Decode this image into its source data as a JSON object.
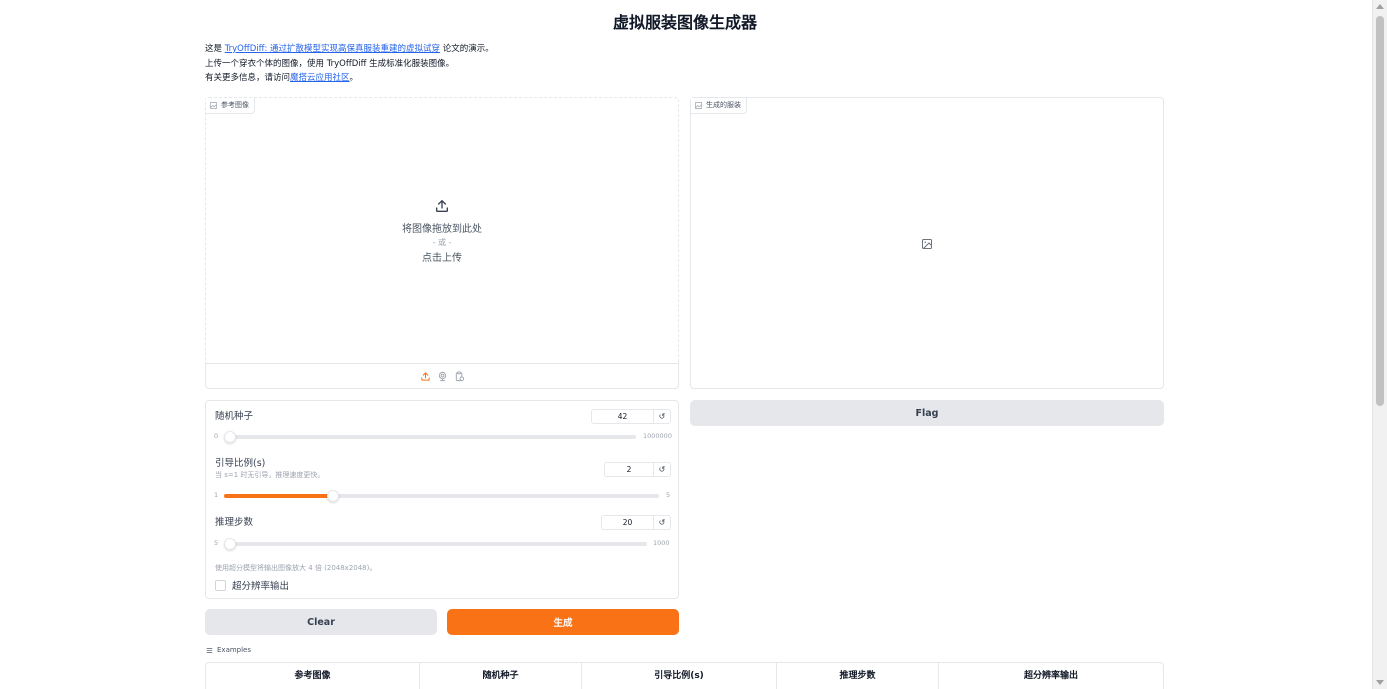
{
  "title": "虚拟服装图像生成器",
  "description": {
    "line1_prefix": "这是 ",
    "line1_link": "TryOffDiff: 通过扩散模型实现高保真服装重建的虚拟试穿",
    "line1_suffix": " 论文的演示。",
    "line2": "上传一个穿衣个体的图像，使用 TryOffDiff 生成标准化服装图像。",
    "line3_prefix": "有关更多信息，请访问",
    "line3_link": "魔搭云应用社区",
    "line3_suffix": "。"
  },
  "input_panel": {
    "label": "参考图像",
    "drop_text": "将图像拖放到此处",
    "or_text": "- 或 -",
    "click_text": "点击上传"
  },
  "output_panel": {
    "label": "生成的服装"
  },
  "seed": {
    "label": "随机种子",
    "value": "42",
    "min": "0",
    "max": "1000000",
    "level": 4.2e-05
  },
  "guidance": {
    "label": "引导比例(s)",
    "info": "当 s=1 时无引导，推理速度更快。",
    "value": "2",
    "min": "1",
    "max": "5",
    "level": 0.25
  },
  "steps": {
    "label": "推理步数",
    "value": "20",
    "min": "5",
    "max": "1000",
    "level": 0.015
  },
  "superres": {
    "info": "使用超分模型将输出图像放大 4 倍 (2048x2048)。",
    "label": "超分辨率输出"
  },
  "buttons": {
    "flag": "Flag",
    "clear": "Clear",
    "generate": "生成"
  },
  "examples": {
    "label": "Examples",
    "headers": [
      "参考图像",
      "随机种子",
      "引导比例(s)",
      "推理步数",
      "超分辨率输出"
    ]
  },
  "colors": {
    "accent": "#f97316",
    "link": "#2563eb",
    "secondary_button": "#e5e7eb"
  },
  "icons": {
    "upload": "upload-icon",
    "image_placeholder": "image-icon",
    "webcam": "webcam-icon",
    "clipboard": "clipboard-icon",
    "reset": "reset-icon"
  }
}
